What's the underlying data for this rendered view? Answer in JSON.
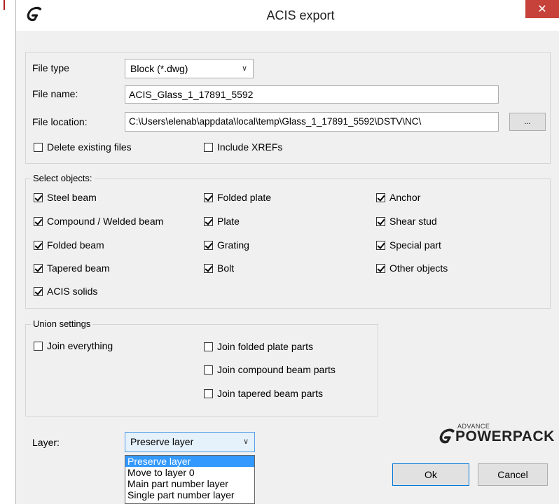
{
  "window": {
    "title": "ACIS export",
    "close_label": "✕"
  },
  "file_section": {
    "file_type_label": "File type",
    "file_type_value": "Block (*.dwg)",
    "file_name_label": "File name:",
    "file_name_value": "ACIS_Glass_1_17891_5592",
    "file_location_label": "File location:",
    "file_location_value": "C:\\Users\\elenab\\appdata\\local\\temp\\Glass_1_17891_5592\\DSTV\\NC\\",
    "browse_label": "...",
    "delete_existing_label": "Delete existing files",
    "delete_existing_checked": false,
    "include_xrefs_label": "Include XREFs",
    "include_xrefs_checked": false
  },
  "select_objects": {
    "legend": "Select objects:",
    "items": [
      {
        "label": "Steel beam",
        "checked": true
      },
      {
        "label": "Folded plate",
        "checked": true
      },
      {
        "label": "Anchor",
        "checked": true
      },
      {
        "label": "Compound / Welded beam",
        "checked": true
      },
      {
        "label": "Plate",
        "checked": true
      },
      {
        "label": "Shear stud",
        "checked": true
      },
      {
        "label": "Folded beam",
        "checked": true
      },
      {
        "label": "Grating",
        "checked": true
      },
      {
        "label": "Special part",
        "checked": true
      },
      {
        "label": "Tapered beam",
        "checked": true
      },
      {
        "label": "Bolt",
        "checked": true
      },
      {
        "label": "Other objects",
        "checked": true
      },
      {
        "label": "ACIS solids",
        "checked": true
      }
    ]
  },
  "union_settings": {
    "legend": "Union settings",
    "items": [
      {
        "label": "Join everything",
        "checked": false
      },
      {
        "label": "Join folded plate parts",
        "checked": false
      },
      {
        "label": "Join compound beam parts",
        "checked": false
      },
      {
        "label": "Join tapered beam parts",
        "checked": false
      }
    ]
  },
  "layer": {
    "label": "Layer:",
    "value": "Preserve layer",
    "options": [
      "Preserve layer",
      "Move to layer 0",
      "Main part number layer",
      "Single part number layer"
    ]
  },
  "brand": {
    "small": "ADVANCE",
    "big": "POWERPACK",
    "color": "#222222"
  },
  "buttons": {
    "ok_label": "Ok",
    "cancel_label": "Cancel"
  },
  "colors": {
    "close_button": "#c7423a",
    "selection": "#3399ff",
    "dialog_background": "#f0f0f0"
  }
}
